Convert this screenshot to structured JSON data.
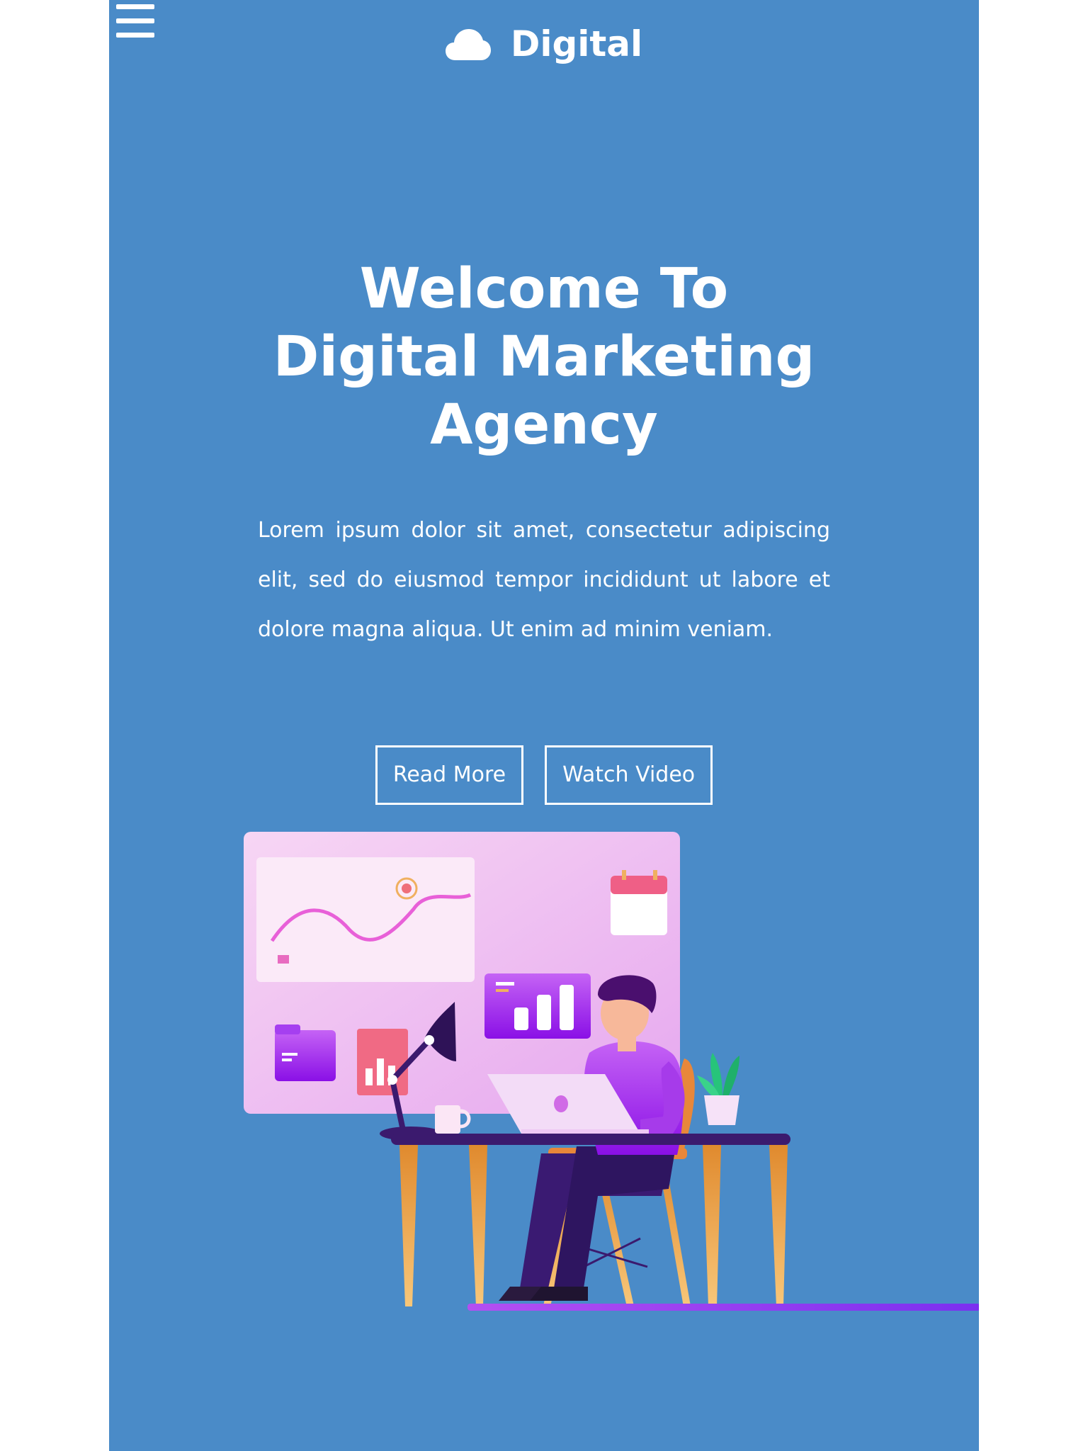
{
  "header": {
    "logo_icon": "cloud-icon",
    "menu_icon": "hamburger-menu-icon",
    "brand": "Digital"
  },
  "hero": {
    "title_lines": [
      "Welcome To",
      "Digital Marketing",
      "Agency"
    ],
    "description": "Lorem ipsum dolor sit amet, consectetur adipiscing elit, sed do eiusmod tempor incididunt ut labore et dolore magna aliqua. Ut enim ad minim veniam.",
    "buttons": {
      "read_more": "Read More",
      "watch_video": "Watch Video"
    },
    "illustration": "person-working-at-desk-with-analytics-board"
  },
  "colors": {
    "background": "#4a8bc8",
    "text": "#ffffff",
    "page": "#ffffff",
    "accent_purple": "#9b30f0"
  }
}
